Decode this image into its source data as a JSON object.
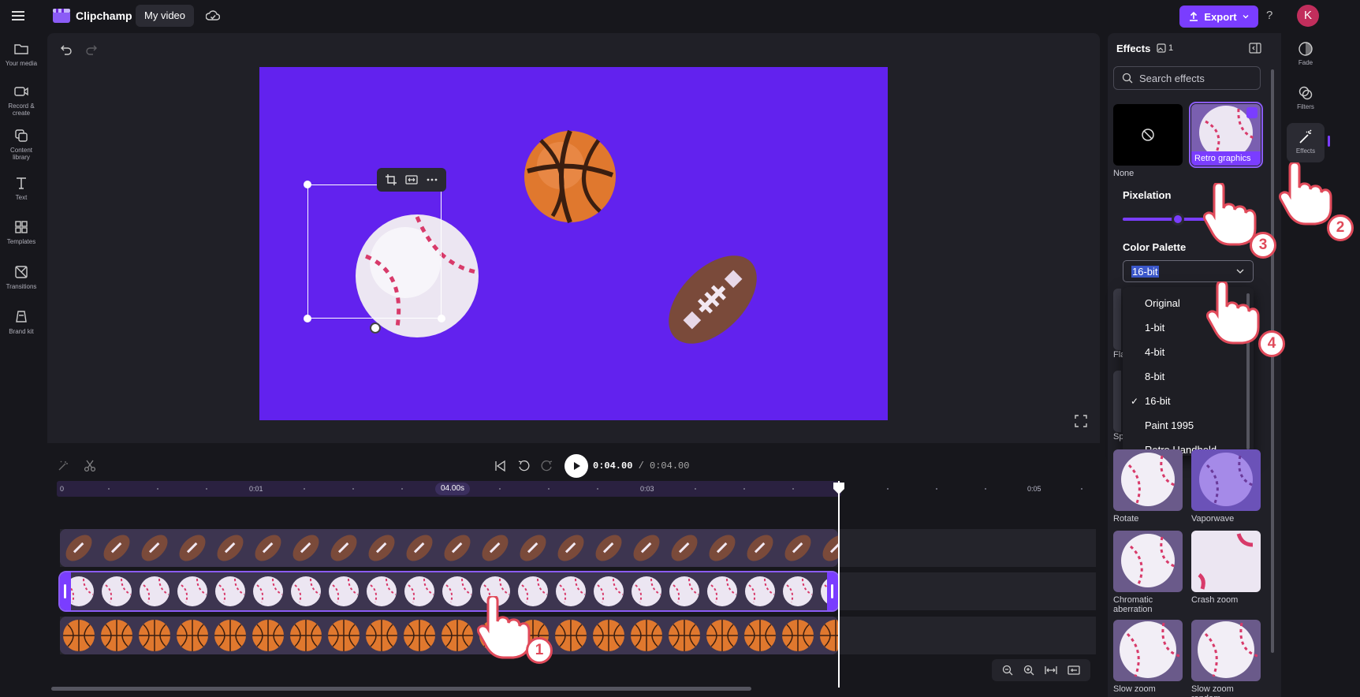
{
  "topbar": {
    "app_name": "Clipchamp",
    "project_tab": "My video",
    "export_label": "Export",
    "help": "?",
    "avatar_initial": "K"
  },
  "leftnav": {
    "items": [
      {
        "label": "Your media",
        "icon": "folder-icon"
      },
      {
        "label": "Record & create",
        "icon": "camera-icon"
      },
      {
        "label": "Content library",
        "icon": "library-icon"
      },
      {
        "label": "Text",
        "icon": "text-icon"
      },
      {
        "label": "Templates",
        "icon": "templates-icon"
      },
      {
        "label": "Transitions",
        "icon": "transitions-icon"
      },
      {
        "label": "Brand kit",
        "icon": "brand-kit-icon"
      }
    ]
  },
  "player": {
    "current_time": "0:04.00",
    "separator": " / ",
    "total_time": "0:04.00"
  },
  "ruler": {
    "labels": [
      "0",
      "0:01",
      "0:03",
      "0:05"
    ],
    "playhead_badge": "04.00s"
  },
  "panel": {
    "title": "Effects",
    "count": "1",
    "search_placeholder": "Search effects",
    "cards": [
      {
        "label": "None"
      },
      {
        "label": "Retro graphics",
        "selected": true
      },
      {
        "label": "Rotate"
      },
      {
        "label": "Vaporwave"
      },
      {
        "label": "Chromatic aberration"
      },
      {
        "label": "Crash zoom"
      },
      {
        "label": "Slow zoom"
      },
      {
        "label": "Slow zoom random"
      }
    ],
    "partial_labels": [
      "Fla",
      "Sp"
    ],
    "pixelation_label": "Pixelation",
    "pixelation_value": 0.6,
    "palette_label": "Color Palette",
    "palette_value": "16-bit",
    "palette_options": [
      "Original",
      "1-bit",
      "4-bit",
      "8-bit",
      "16-bit",
      "Paint 1995",
      "Retro Handheld"
    ],
    "palette_checked": "16-bit"
  },
  "rail": {
    "items": [
      {
        "label": "Fade",
        "icon": "fade-icon"
      },
      {
        "label": "Filters",
        "icon": "filters-icon"
      },
      {
        "label": "Effects",
        "icon": "effects-wand-icon",
        "active": true
      }
    ]
  },
  "steps": [
    "1",
    "2",
    "3",
    "4"
  ],
  "colors": {
    "accent": "#7a3dff",
    "canvas_bg": "#6222ee",
    "step_red": "#e04a5a"
  }
}
